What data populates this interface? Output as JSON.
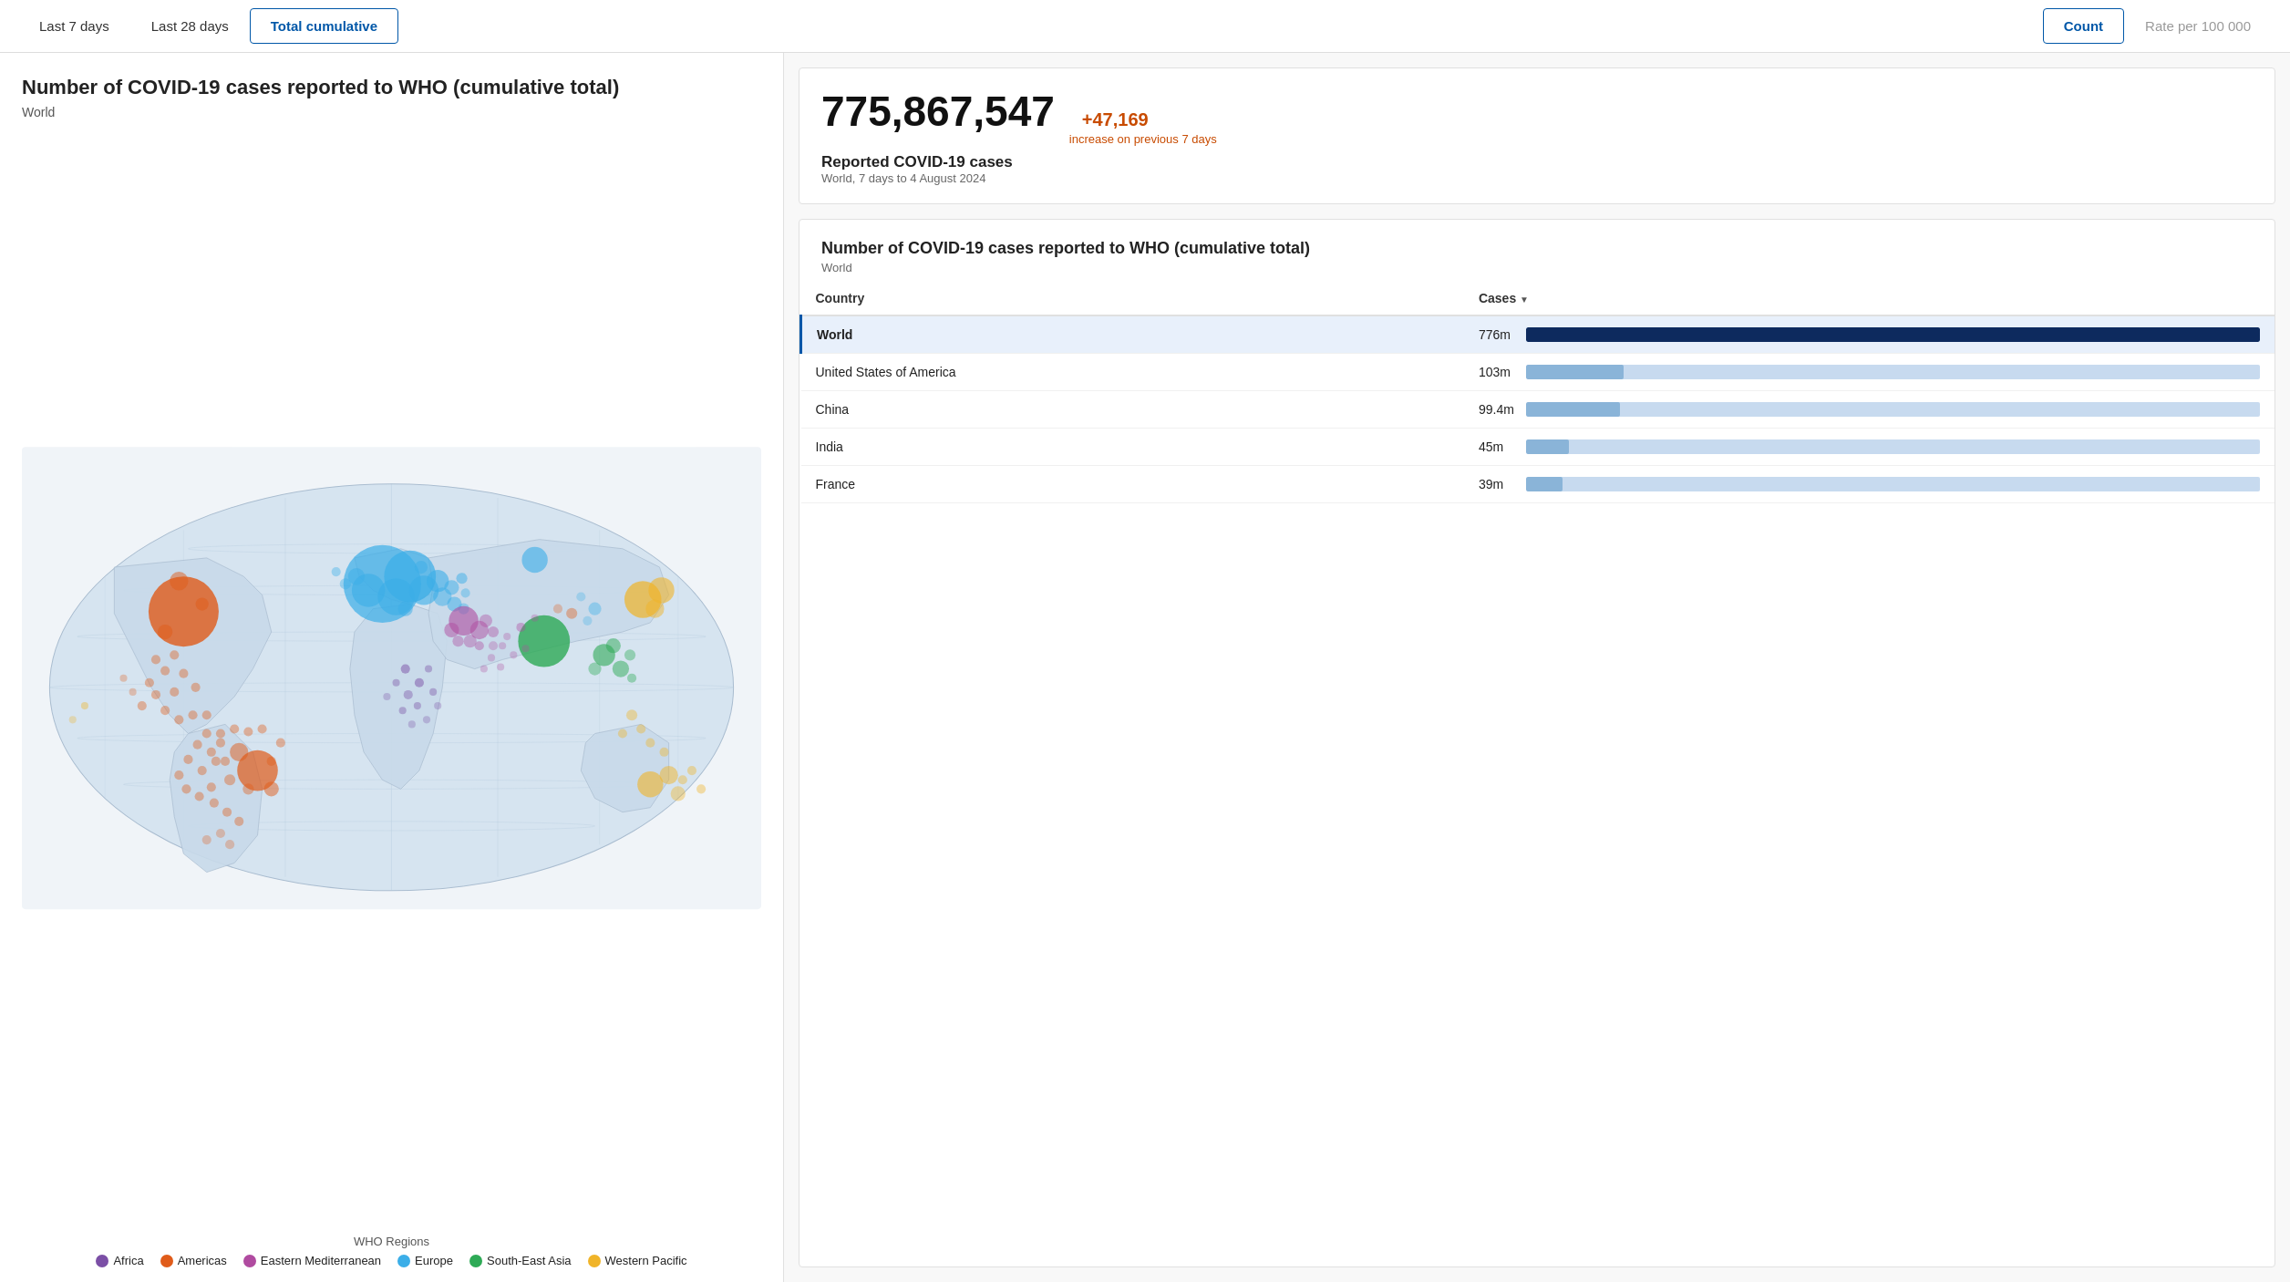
{
  "topbar": {
    "time_tabs": [
      {
        "label": "Last 7 days",
        "active": false
      },
      {
        "label": "Last 28 days",
        "active": false
      },
      {
        "label": "Total cumulative",
        "active": true
      }
    ],
    "metric_tabs": [
      {
        "label": "Count",
        "active": true
      },
      {
        "label": "Rate per 100 000",
        "active": false
      }
    ]
  },
  "map": {
    "title": "Number of COVID-19 cases reported to WHO (cumulative total)",
    "subtitle": "World",
    "legend_title": "WHO Regions",
    "legend_items": [
      {
        "label": "Africa",
        "color": "#7b4fa6"
      },
      {
        "label": "Americas",
        "color": "#e05c1a"
      },
      {
        "label": "Eastern Mediterranean",
        "color": "#b04ba0"
      },
      {
        "label": "Europe",
        "color": "#3baee8"
      },
      {
        "label": "South-East Asia",
        "color": "#2eaa56"
      },
      {
        "label": "Western Pacific",
        "color": "#f0b429"
      }
    ]
  },
  "stats": {
    "big_number": "775,867,547",
    "increase": "+47,169",
    "increase_label": "increase on previous 7 days",
    "reported_label": "Reported COVID-19 cases",
    "period": "World, 7 days to 4 August 2024"
  },
  "table": {
    "title": "Number of COVID-19 cases reported to WHO (cumulative total)",
    "subtitle": "World",
    "col_country": "Country",
    "col_cases": "Cases",
    "rows": [
      {
        "country": "World",
        "cases": "776m",
        "bar_pct": 100,
        "selected": true
      },
      {
        "country": "United States of America",
        "cases": "103m",
        "bar_pct": 13.3,
        "selected": false
      },
      {
        "country": "China",
        "cases": "99.4m",
        "bar_pct": 12.8,
        "selected": false
      },
      {
        "country": "India",
        "cases": "45m",
        "bar_pct": 5.8,
        "selected": false
      },
      {
        "country": "France",
        "cases": "39m",
        "bar_pct": 5.0,
        "selected": false
      }
    ]
  }
}
